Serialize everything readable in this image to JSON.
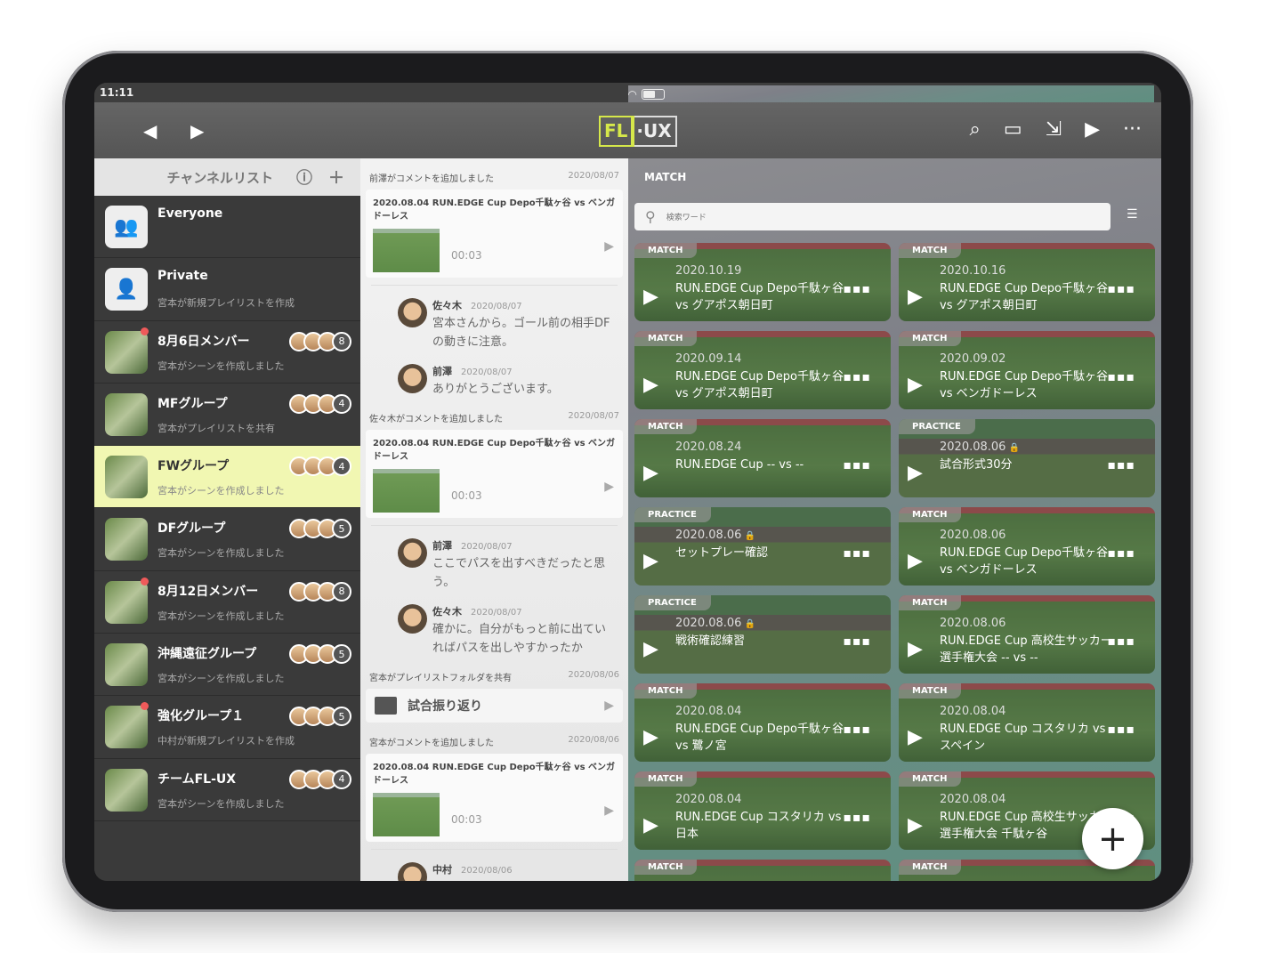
{
  "status": {
    "time": "11:11"
  },
  "toolbar": {
    "logo_left": "FL",
    "logo_right": "·UX"
  },
  "channels": {
    "title": "チャンネルリスト",
    "items": [
      {
        "name": "Everyone",
        "sub": "",
        "icon": "group-icon"
      },
      {
        "name": "Private",
        "sub": "宮本が新規プレイリストを作成",
        "icon": "private-user-icon"
      },
      {
        "name": "8月6日メンバー",
        "sub": "宮本がシーンを作成しました",
        "count": "8",
        "unread": true
      },
      {
        "name": "MFグループ",
        "sub": "宮本がプレイリストを共有",
        "count": "4"
      },
      {
        "name": "FWグループ",
        "sub": "宮本がシーンを作成しました",
        "count": "4",
        "selected": true
      },
      {
        "name": "DFグループ",
        "sub": "宮本がシーンを作成しました",
        "count": "5"
      },
      {
        "name": "8月12日メンバー",
        "sub": "宮本がシーンを作成しました",
        "count": "8",
        "unread": true
      },
      {
        "name": "沖縄遠征グループ",
        "sub": "宮本がシーンを作成しました",
        "count": "5"
      },
      {
        "name": "強化グループ１",
        "sub": "中村が新規プレイリストを作成",
        "count": "5",
        "unread": true
      },
      {
        "name": "チームFL-UX",
        "sub": "宮本がシーンを作成しました",
        "count": "4"
      }
    ]
  },
  "feed": [
    {
      "type": "video",
      "head": "前澤がコメントを追加しました",
      "date": "2020/08/07",
      "title": "2020.08.04 RUN.EDGE Cup Depo千駄ヶ谷 vs ベンガドーレス",
      "duration": "00:03",
      "comments": [
        {
          "who": "佐々木",
          "date": "2020/08/07",
          "text": "宮本さんから。ゴール前の相手DFの動きに注意。"
        },
        {
          "who": "前澤",
          "date": "2020/08/07",
          "text": "ありがとうございます。"
        }
      ]
    },
    {
      "type": "video",
      "head": "佐々木がコメントを追加しました",
      "date": "2020/08/07",
      "title": "2020.08.04 RUN.EDGE Cup Depo千駄ヶ谷 vs ベンガドーレス",
      "duration": "00:03",
      "comments": [
        {
          "who": "前澤",
          "date": "2020/08/07",
          "text": "ここでパスを出すべきだったと思う。"
        },
        {
          "who": "佐々木",
          "date": "2020/08/07",
          "text": "確かに。自分がもっと前に出ていればパスを出しやすかったか"
        }
      ]
    },
    {
      "type": "folder",
      "head": "宮本がプレイリストフォルダを共有",
      "date": "2020/08/06",
      "title": "試合振り返り"
    },
    {
      "type": "video",
      "head": "宮本がコメントを追加しました",
      "date": "2020/08/06",
      "title": "2020.08.04 RUN.EDGE Cup Depo千駄ヶ谷 vs ベンガドーレス",
      "duration": "00:03",
      "comments": [
        {
          "who": "中村",
          "date": "2020/08/06",
          "text": ""
        }
      ]
    }
  ],
  "library": {
    "title": "MATCH",
    "search_placeholder": "検索ワード",
    "videos": [
      {
        "tag": "MATCH",
        "date": "2020.10.19",
        "title": "RUN.EDGE Cup Depo千駄ヶ谷 vs グアポス朝日町"
      },
      {
        "tag": "MATCH",
        "date": "2020.10.16",
        "title": "RUN.EDGE Cup Depo千駄ヶ谷 vs グアポス朝日町"
      },
      {
        "tag": "MATCH",
        "date": "2020.09.14",
        "title": "RUN.EDGE Cup Depo千駄ヶ谷 vs グアポス朝日町"
      },
      {
        "tag": "MATCH",
        "date": "2020.09.02",
        "title": "RUN.EDGE Cup Depo千駄ヶ谷 vs ベンガドーレス"
      },
      {
        "tag": "MATCH",
        "date": "2020.08.24",
        "title": "RUN.EDGE Cup -- vs --"
      },
      {
        "tag": "PRACTICE",
        "date": "2020.08.06",
        "title": "試合形式30分",
        "locked": true
      },
      {
        "tag": "PRACTICE",
        "date": "2020.08.06",
        "title": "セットプレー確認",
        "locked": true
      },
      {
        "tag": "MATCH",
        "date": "2020.08.06",
        "title": "RUN.EDGE Cup Depo千駄ヶ谷 vs ベンガドーレス"
      },
      {
        "tag": "PRACTICE",
        "date": "2020.08.06",
        "title": "戦術確認練習",
        "locked": true
      },
      {
        "tag": "MATCH",
        "date": "2020.08.06",
        "title": "RUN.EDGE Cup 高校生サッカー選手権大会 -- vs --"
      },
      {
        "tag": "MATCH",
        "date": "2020.08.04",
        "title": "RUN.EDGE Cup Depo千駄ヶ谷 vs 鷺ノ宮"
      },
      {
        "tag": "MATCH",
        "date": "2020.08.04",
        "title": "RUN.EDGE Cup コスタリカ vs スペイン"
      },
      {
        "tag": "MATCH",
        "date": "2020.08.04",
        "title": "RUN.EDGE Cup コスタリカ vs 日本"
      },
      {
        "tag": "MATCH",
        "date": "2020.08.04",
        "title": "RUN.EDGE Cup 高校生サッカー選手権大会 千駄ヶ谷"
      },
      {
        "tag": "MATCH",
        "date": "",
        "title": ""
      },
      {
        "tag": "MATCH",
        "date": "",
        "title": ""
      }
    ]
  },
  "colors": {
    "accent": "#d6e84a",
    "selected_row": "#f1f7b2",
    "unread_dot": "#ef5a5a"
  }
}
